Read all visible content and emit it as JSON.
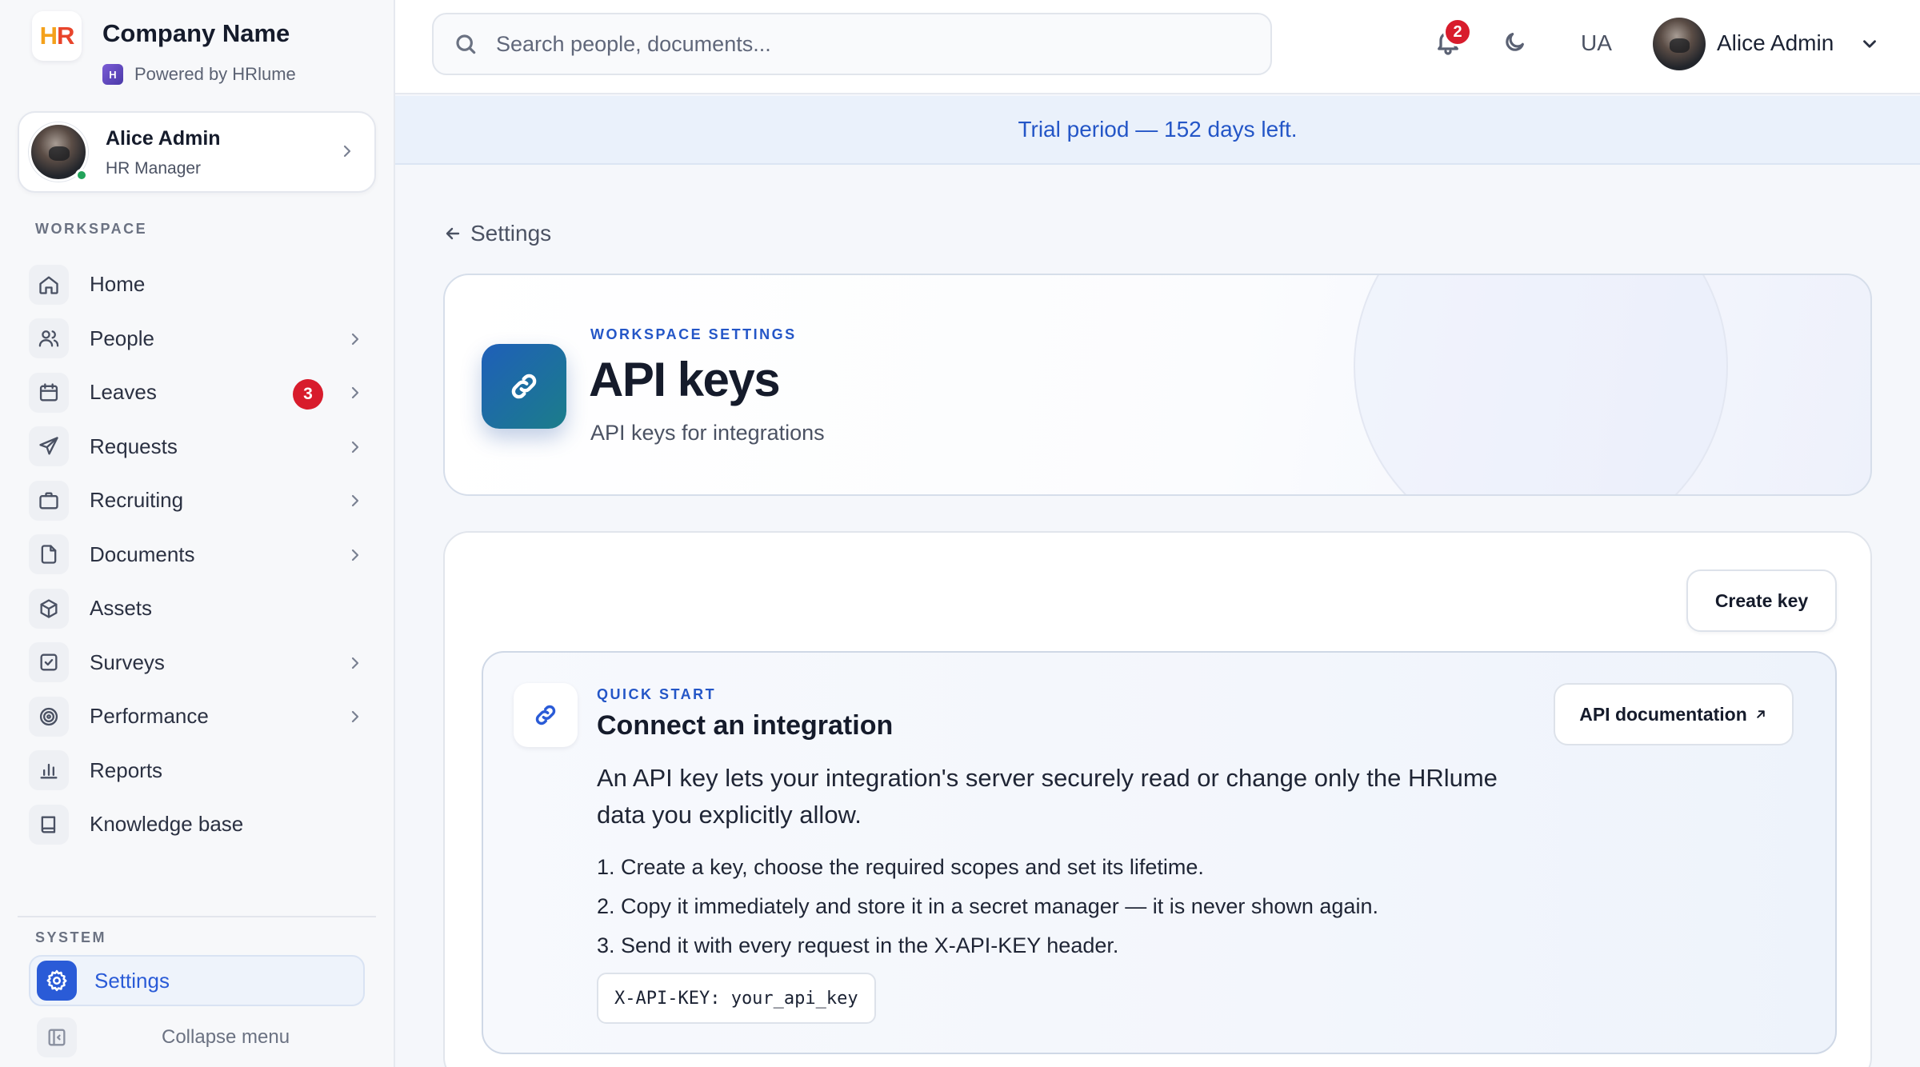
{
  "brand": {
    "company_name": "Company Name",
    "logo_text_h": "H",
    "logo_text_r": "R",
    "powered_by": "Powered by HRlume"
  },
  "profile": {
    "name": "Alice Admin",
    "role": "HR Manager"
  },
  "sidebar": {
    "workspace_label": "WORKSPACE",
    "system_label": "SYSTEM",
    "items": [
      {
        "label": "Home",
        "icon": "home-icon",
        "chevron": false
      },
      {
        "label": "People",
        "icon": "people-icon",
        "chevron": true
      },
      {
        "label": "Leaves",
        "icon": "calendar-icon",
        "chevron": true,
        "badge": "3"
      },
      {
        "label": "Requests",
        "icon": "send-icon",
        "chevron": true
      },
      {
        "label": "Recruiting",
        "icon": "briefcase-icon",
        "chevron": true
      },
      {
        "label": "Documents",
        "icon": "document-icon",
        "chevron": true
      },
      {
        "label": "Assets",
        "icon": "box-icon",
        "chevron": false
      },
      {
        "label": "Surveys",
        "icon": "checkbox-icon",
        "chevron": true
      },
      {
        "label": "Performance",
        "icon": "target-icon",
        "chevron": true
      },
      {
        "label": "Reports",
        "icon": "bar-chart-icon",
        "chevron": false
      },
      {
        "label": "Knowledge base",
        "icon": "book-icon",
        "chevron": false
      }
    ],
    "settings_label": "Settings",
    "collapse_label": "Collapse menu"
  },
  "topbar": {
    "search_placeholder": "Search people, documents...",
    "notification_count": "2",
    "language": "UA",
    "user_name": "Alice Admin"
  },
  "trial_banner": "Trial period — 152 days left.",
  "breadcrumb": {
    "back_label": "Settings"
  },
  "hero": {
    "eyebrow": "WORKSPACE SETTINGS",
    "title": "API keys",
    "subtitle": "API keys for integrations"
  },
  "panel": {
    "create_key_label": "Create key",
    "quick_start": {
      "eyebrow": "QUICK START",
      "title": "Connect an integration",
      "description": "An API key lets your integration's server securely read or change only the HRlume data you explicitly allow.",
      "steps": [
        "1. Create a key, choose the required scopes and set its lifetime.",
        "2. Copy it immediately and store it in a secret manager — it is never shown again.",
        "3. Send it with every request in the X-API-KEY header."
      ],
      "code_sample": "X-API-KEY: your_api_key",
      "docs_button": "API documentation"
    }
  },
  "colors": {
    "accent": "#2a5bd7",
    "badge": "#d81c2c",
    "trial_banner_bg": "#eaf1fb",
    "online": "#22a35a"
  }
}
